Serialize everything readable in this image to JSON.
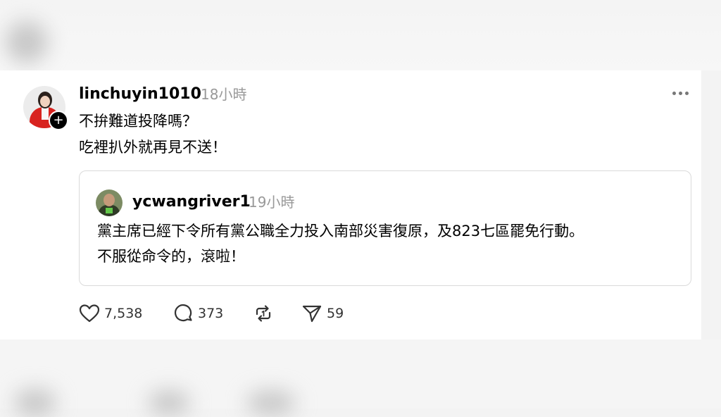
{
  "post": {
    "username": "linchuyin1010",
    "time": "18小時",
    "lines": [
      "不拚難道投降嗎？",
      "吃裡扒外就再見不送！"
    ],
    "follow_symbol": "+",
    "menu_icon": "more-horizontal-icon"
  },
  "quote": {
    "username": "ycwangriver1",
    "time": "19小時",
    "lines": [
      "黨主席已經下令所有黨公職全力投入南部災害復原，及823七區罷免行動。",
      "不服從命令的，滾啦！"
    ]
  },
  "actions": {
    "likes": "7,538",
    "replies": "373",
    "shares": "59",
    "icons": [
      "heart-icon",
      "comment-icon",
      "repost-icon",
      "send-icon"
    ]
  }
}
